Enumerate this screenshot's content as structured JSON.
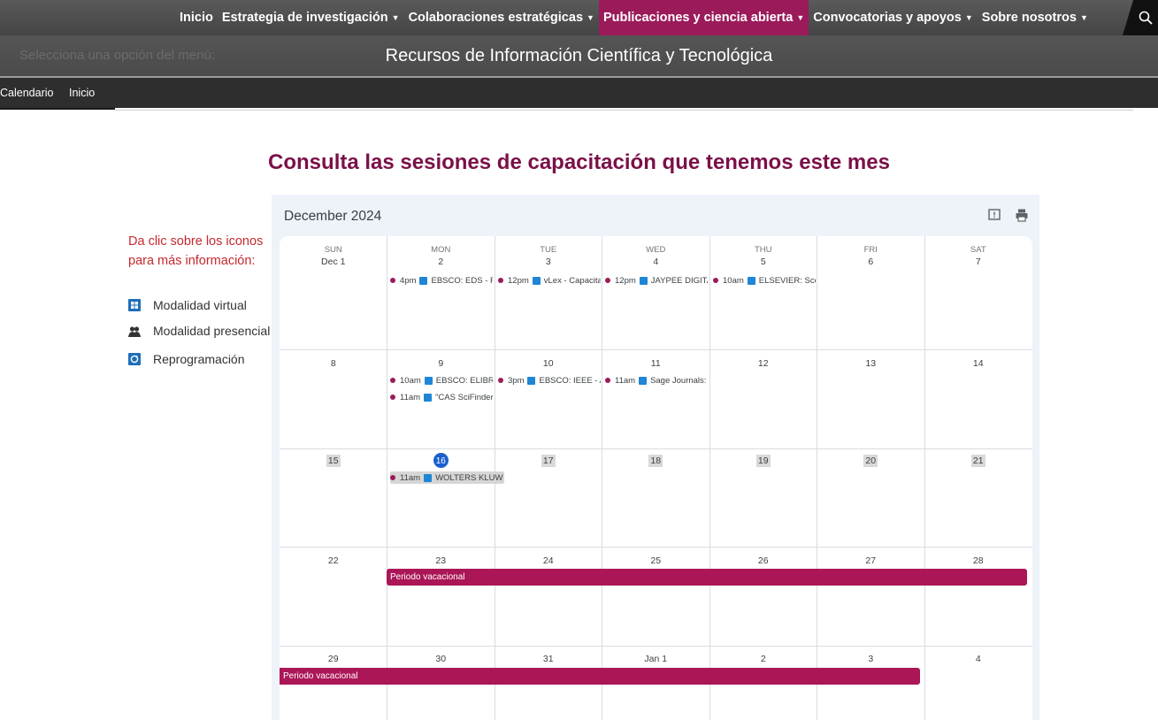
{
  "topnav": {
    "items": [
      {
        "label": "Inicio"
      },
      {
        "label": "Estrategia de investigación"
      },
      {
        "label": "Colaboraciones estratégicas"
      },
      {
        "label": "Publicaciones y ciencia abierta"
      },
      {
        "label": "Convocatorias y apoyos"
      },
      {
        "label": "Sobre nosotros"
      }
    ],
    "active_index": 3,
    "search_icon": "search-icon"
  },
  "subbar": {
    "menu_prompt": "Selecciona una opción del menú:",
    "title": "Recursos de Información Científica y Tecnológica"
  },
  "breadcrumb": {
    "items": [
      "Calendario",
      "Inicio"
    ]
  },
  "headline": "Consulta las sesiones de capacitación que tenemos este mes",
  "legend": {
    "hint": "Da clic sobre los iconos para más información:",
    "hint_line1": "Da clic sobre los iconos",
    "hint_line2": "para más información:",
    "items": [
      {
        "icon": "virtual-icon",
        "label": "Modalidad virtual"
      },
      {
        "icon": "presencial-icon",
        "label": "Modalidad presencial"
      },
      {
        "icon": "reschedule-icon",
        "label": "Reprogramación"
      }
    ]
  },
  "calendar": {
    "month_label": "December 2024",
    "colors": {
      "accent": "#9b1b5a",
      "band": "#ab1657",
      "virtual": "#1f86d6",
      "today": "#1a5fcc"
    },
    "weekdays": [
      "SUN",
      "MON",
      "TUE",
      "WED",
      "THU",
      "FRI",
      "SAT"
    ],
    "weeks": [
      [
        "Dec 1",
        "2",
        "3",
        "4",
        "5",
        "6",
        "7"
      ],
      [
        "8",
        "9",
        "10",
        "11",
        "12",
        "13",
        "14"
      ],
      [
        "15",
        "16",
        "17",
        "18",
        "19",
        "20",
        "21"
      ],
      [
        "22",
        "23",
        "24",
        "25",
        "26",
        "27",
        "28"
      ],
      [
        "29",
        "30",
        "31",
        "Jan 1",
        "2",
        "3",
        "4"
      ]
    ],
    "events": {
      "w0_mon": {
        "time": "4pm",
        "title": "EBSCO: EDS - Re"
      },
      "w0_tue": {
        "time": "12pm",
        "title": "vLex - Capacita"
      },
      "w0_wed": {
        "time": "12pm",
        "title": "JAYPEE DIGITAL"
      },
      "w0_thu": {
        "time": "10am",
        "title": "ELSEVIER: Scop"
      },
      "w1_mon_a": {
        "time": "10am",
        "title": "EBSCO: ELIBRO"
      },
      "w1_tue": {
        "time": "3pm",
        "title": "EBSCO: IEEE - A|"
      },
      "w1_wed": {
        "time": "11am",
        "title": "Sage Journals: S"
      },
      "w1_mon_b": {
        "time": "11am",
        "title": "\"CAS SciFinder I"
      },
      "w2_mon": {
        "time": "11am",
        "title": "WOLTERS KLUW"
      }
    },
    "bands": {
      "w3": "Periodo vacacional",
      "w4": "Periodo vacacional"
    }
  }
}
